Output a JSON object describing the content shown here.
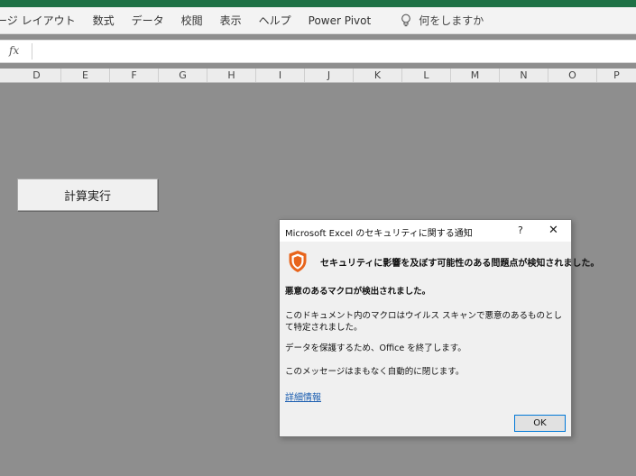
{
  "ribbon": {
    "tabs": [
      "ージ レイアウト",
      "数式",
      "データ",
      "校閲",
      "表示",
      "ヘルプ",
      "Power Pivot"
    ],
    "tell_me": "何をしますか"
  },
  "formula_bar": {
    "fx_label": "fx",
    "value": ""
  },
  "columns": [
    "D",
    "E",
    "F",
    "G",
    "H",
    "I",
    "J",
    "K",
    "L",
    "M",
    "N",
    "O",
    "P"
  ],
  "sheet": {
    "macro_button_label": "計算実行"
  },
  "dialog": {
    "title": "Microsoft Excel のセキュリティに関する通知",
    "help": "?",
    "close": "✕",
    "heading": "セキュリティに影響を及ぼす可能性のある問題点が検知されました。",
    "bold_line": "悪意のあるマクロが検出されました。",
    "para1": "このドキュメント内のマクロはウイルス スキャンで悪意のあるものとして特定されました。",
    "para2": "データを保護するため、Office を終了します。",
    "para3": "このメッセージはまもなく自動的に閉じます。",
    "link": "詳細情報",
    "ok": "OK",
    "shield_color": "#e8641b"
  }
}
